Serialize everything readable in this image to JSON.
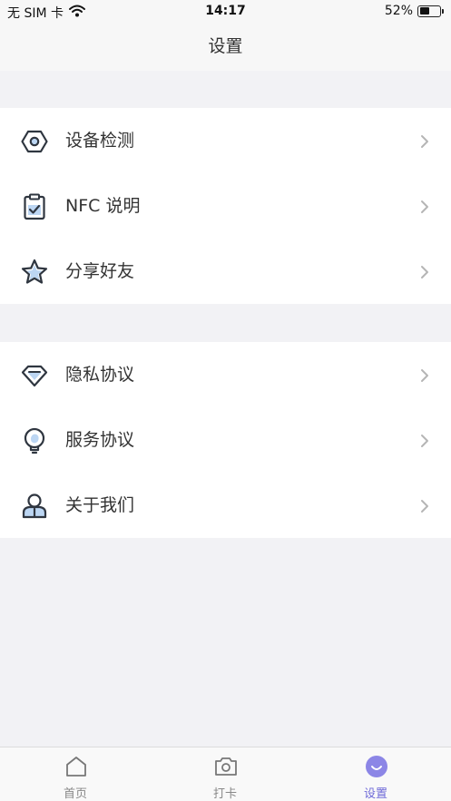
{
  "status_bar": {
    "carrier": "无 SIM 卡",
    "time": "14:17",
    "battery_percent": "52%",
    "battery_level": 0.52,
    "wifi_icon": "wifi-icon"
  },
  "nav": {
    "title": "设置"
  },
  "groups": [
    {
      "items": [
        {
          "label": "设备检测",
          "icon": "hexagon-nut-icon"
        },
        {
          "label": "NFC 说明",
          "icon": "clipboard-check-icon"
        },
        {
          "label": "分享好友",
          "icon": "star-icon"
        }
      ]
    },
    {
      "items": [
        {
          "label": "隐私协议",
          "icon": "diamond-icon"
        },
        {
          "label": "服务协议",
          "icon": "lightbulb-icon"
        },
        {
          "label": "关于我们",
          "icon": "user-icon"
        }
      ]
    }
  ],
  "tab_bar": {
    "tabs": [
      {
        "label": "首页",
        "icon": "home-icon",
        "active": false
      },
      {
        "label": "打卡",
        "icon": "camera-icon",
        "active": false
      },
      {
        "label": "设置",
        "icon": "smile-icon",
        "active": true
      }
    ]
  },
  "colors": {
    "accent": "#6f6ad8",
    "icon_fill": "#bcd6f3",
    "background": "#f2f2f5"
  }
}
